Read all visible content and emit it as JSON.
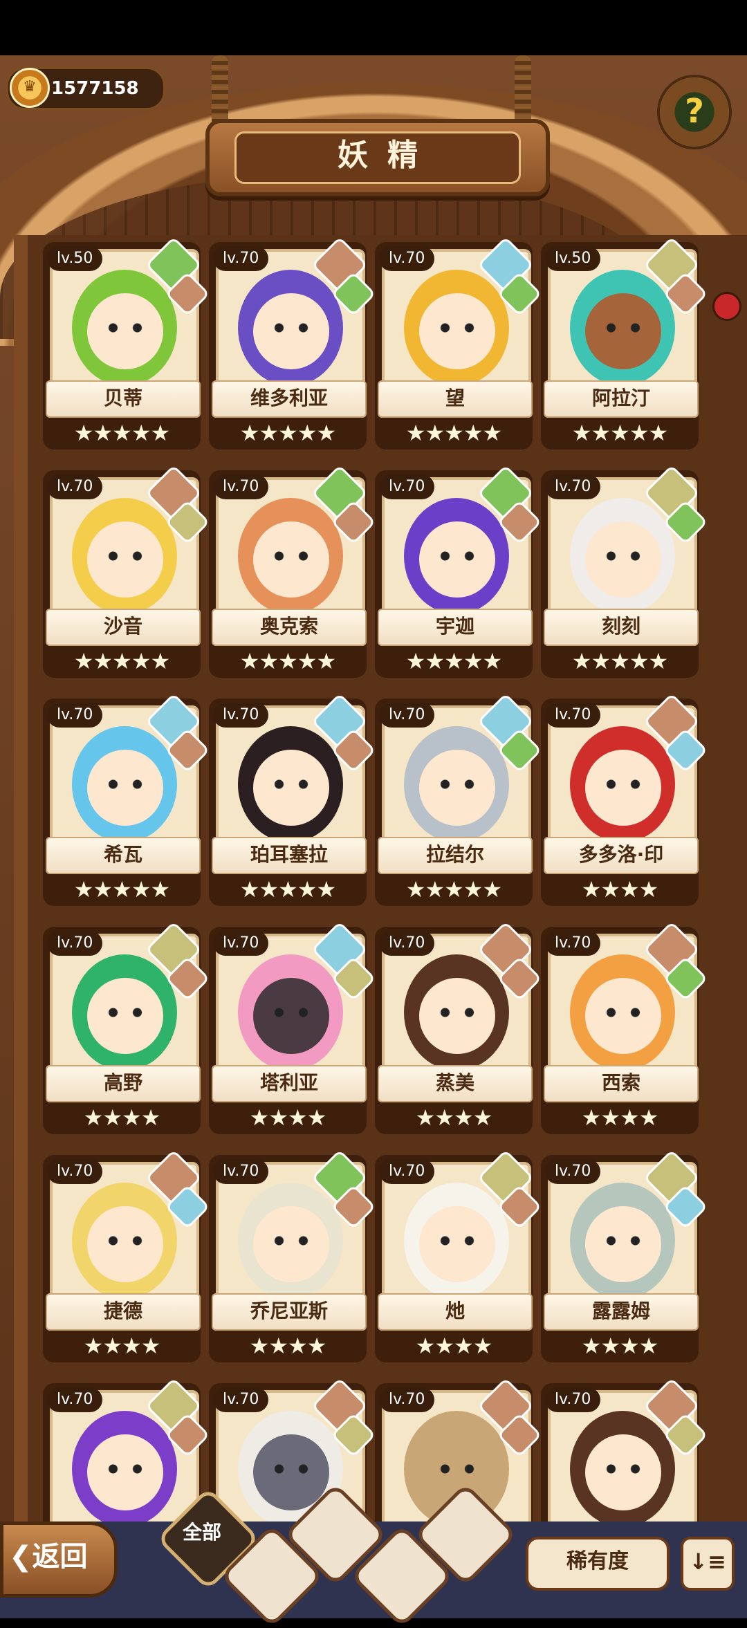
{
  "header": {
    "coins": "1577158",
    "title": "妖精",
    "help_label": "?"
  },
  "cards": [
    {
      "level": "lv.50",
      "name": "贝蒂",
      "stars": 5,
      "element": "wood",
      "element2": "mtn",
      "hair": "#7fc63a",
      "skin": "#fde7cf"
    },
    {
      "level": "lv.70",
      "name": "维多利亚",
      "stars": 5,
      "element": "mtn",
      "element2": "wood",
      "hair": "#6a4fc4",
      "skin": "#fde7cf"
    },
    {
      "level": "lv.70",
      "name": "望",
      "stars": 5,
      "element": "water",
      "element2": "wood",
      "hair": "#f1b733",
      "skin": "#fde7cf"
    },
    {
      "level": "lv.50",
      "name": "阿拉汀",
      "stars": 5,
      "element": "earth",
      "element2": "mtn",
      "hair": "#3fc4b4",
      "skin": "#a5643a"
    },
    {
      "level": "lv.70",
      "name": "沙音",
      "stars": 5,
      "element": "mtn",
      "element2": "earth",
      "hair": "#f4cd4a",
      "skin": "#fde7cf"
    },
    {
      "level": "lv.70",
      "name": "奥克索",
      "stars": 5,
      "element": "wood",
      "element2": "mtn",
      "hair": "#e6905a",
      "skin": "#fde7cf"
    },
    {
      "level": "lv.70",
      "name": "宇迦",
      "stars": 5,
      "element": "wood",
      "element2": "mtn",
      "hair": "#6b3fc8",
      "skin": "#fde7cf"
    },
    {
      "level": "lv.70",
      "name": "刻刻",
      "stars": 5,
      "element": "earth",
      "element2": "wood",
      "hair": "#f0ecea",
      "skin": "#fde7cf"
    },
    {
      "level": "lv.70",
      "name": "希瓦",
      "stars": 5,
      "element": "water",
      "element2": "mtn",
      "hair": "#66c5ea",
      "skin": "#fde7cf"
    },
    {
      "level": "lv.70",
      "name": "珀耳塞拉",
      "stars": 5,
      "element": "water",
      "element2": "mtn",
      "hair": "#2b1f22",
      "skin": "#fde7cf"
    },
    {
      "level": "lv.70",
      "name": "拉结尔",
      "stars": 5,
      "element": "water",
      "element2": "wood",
      "hair": "#b8c0c9",
      "skin": "#fde7cf"
    },
    {
      "level": "lv.70",
      "name": "多多洛·印",
      "stars": 4,
      "element": "mtn",
      "element2": "water",
      "hair": "#d02e2a",
      "skin": "#fde7cf"
    },
    {
      "level": "lv.70",
      "name": "高野",
      "stars": 4,
      "element": "earth",
      "element2": "mtn",
      "hair": "#2fb36a",
      "skin": "#fde7cf"
    },
    {
      "level": "lv.70",
      "name": "塔利亚",
      "stars": 4,
      "element": "water",
      "element2": "earth",
      "hair": "#f29ac2",
      "skin": "#4a3a42"
    },
    {
      "level": "lv.70",
      "name": "蒸美",
      "stars": 4,
      "element": "mtn",
      "element2": "mtn",
      "hair": "#5a3422",
      "skin": "#fde7cf"
    },
    {
      "level": "lv.70",
      "name": "西索",
      "stars": 4,
      "element": "mtn",
      "element2": "wood",
      "hair": "#f3a042",
      "skin": "#fde7cf"
    },
    {
      "level": "lv.70",
      "name": "捷德",
      "stars": 4,
      "element": "mtn",
      "element2": "water",
      "hair": "#f2d56a",
      "skin": "#fde7cf"
    },
    {
      "level": "lv.70",
      "name": "乔尼亚斯",
      "stars": 4,
      "element": "wood",
      "element2": "mtn",
      "hair": "#e9e4d0",
      "skin": "#fde7cf"
    },
    {
      "level": "lv.70",
      "name": "灺",
      "stars": 4,
      "element": "earth",
      "element2": "mtn",
      "hair": "#f6f3ea",
      "skin": "#fde7cf"
    },
    {
      "level": "lv.70",
      "name": "露露姆",
      "stars": 4,
      "element": "earth",
      "element2": "water",
      "hair": "#b5c7bc",
      "skin": "#fde7cf"
    },
    {
      "level": "lv.70",
      "name": "",
      "stars": 0,
      "element": "earth",
      "element2": "mtn",
      "hair": "#7c3ec8",
      "skin": "#fde7cf"
    },
    {
      "level": "lv.70",
      "name": "",
      "stars": 0,
      "element": "mtn",
      "element2": "earth",
      "hair": "#efece6",
      "skin": "#6b6a78"
    },
    {
      "level": "lv.70",
      "name": "",
      "stars": 0,
      "element": "mtn",
      "element2": "mtn",
      "hair": "#c8a676",
      "skin": "#c8a676"
    },
    {
      "level": "lv.70",
      "name": "",
      "stars": 0,
      "element": "mtn",
      "element2": "earth",
      "hair": "#5a3422",
      "skin": "#fde7cf"
    }
  ],
  "bottom": {
    "back_label": "返回",
    "all_label": "全部",
    "rarity_label": "稀有度",
    "sort_label": "↓≡"
  }
}
